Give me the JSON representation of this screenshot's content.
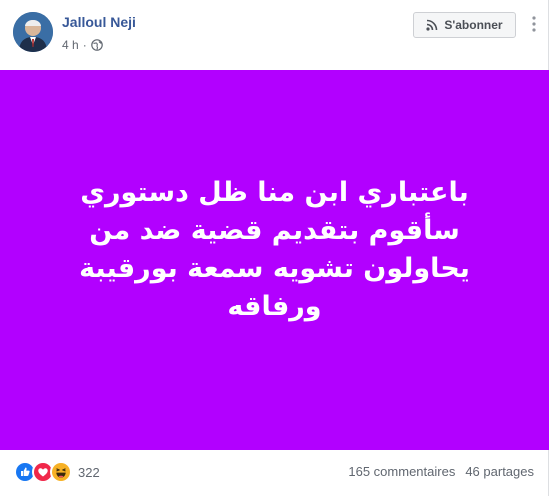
{
  "post": {
    "author": "Jalloul Neji",
    "time": "4 h",
    "separator": "·",
    "privacy_icon": "globe-icon",
    "subscribe_label": "S'abonner",
    "subscribe_icon": "rss-icon",
    "more_icon": "ellipsis-icon",
    "background_color": "#b200ff",
    "text": "باعتباري ابن منا ظل دستوري سأقوم بتقديم قضية ضد من يحاولون تشويه سمعة بورقيبة ورفاقه"
  },
  "engagement": {
    "reaction_icons": [
      "like-icon",
      "love-icon",
      "haha-icon"
    ],
    "reaction_count": "322",
    "comments": "165 commentaires",
    "shares": "46 partages"
  },
  "colors": {
    "link": "#385898",
    "muted": "#616770",
    "like": "#1877f2",
    "love": "#f0284a",
    "haha": "#f7b125"
  }
}
